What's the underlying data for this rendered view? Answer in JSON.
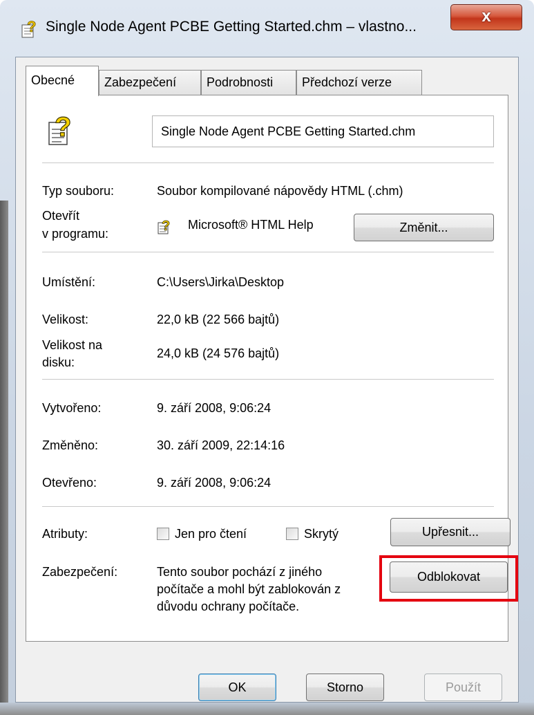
{
  "window": {
    "title": "Single Node Agent PCBE Getting Started.chm – vlastno...",
    "close_label": "x"
  },
  "tabs": [
    {
      "label": "Obecné",
      "active": true
    },
    {
      "label": "Zabezpečení",
      "active": false
    },
    {
      "label": "Podrobnosti",
      "active": false
    },
    {
      "label": "Předchozí verze",
      "active": false
    }
  ],
  "general": {
    "filename": "Single Node Agent PCBE Getting Started.chm",
    "file_type_label": "Typ souboru:",
    "file_type_value": "Soubor kompilované nápovědy HTML (.chm)",
    "open_with_label_1": "Otevřít",
    "open_with_label_2": "v programu:",
    "open_with_value": "Microsoft® HTML Help",
    "change_button": "Změnit...",
    "location_label": "Umístění:",
    "location_value": "C:\\Users\\Jirka\\Desktop",
    "size_label": "Velikost:",
    "size_value": "22,0 kB (22 566 bajtů)",
    "size_on_disk_label_1": "Velikost na",
    "size_on_disk_label_2": "disku:",
    "size_on_disk_value": "24,0 kB (24 576 bajtů)",
    "created_label": "Vytvořeno:",
    "created_value": "9. září 2008, 9:06:24",
    "modified_label": "Změněno:",
    "modified_value": "30. září 2009, 22:14:16",
    "accessed_label": "Otevřeno:",
    "accessed_value": "9. září 2008, 9:06:24",
    "attributes_label": "Atributy:",
    "readonly_label": "Jen pro čtení",
    "hidden_label": "Skrytý",
    "advanced_button": "Upřesnit...",
    "security_label": "Zabezpečení:",
    "security_line_1": "Tento soubor pochází z jiného",
    "security_line_2": "počítače a mohl být zablokován z",
    "security_line_3": "důvodu ochrany počítače.",
    "unblock_button": "Odblokovat"
  },
  "footer": {
    "ok": "OK",
    "cancel": "Storno",
    "apply": "Použít"
  },
  "colors": {
    "highlight": "#e4000f",
    "close_button": "#c2351b"
  }
}
